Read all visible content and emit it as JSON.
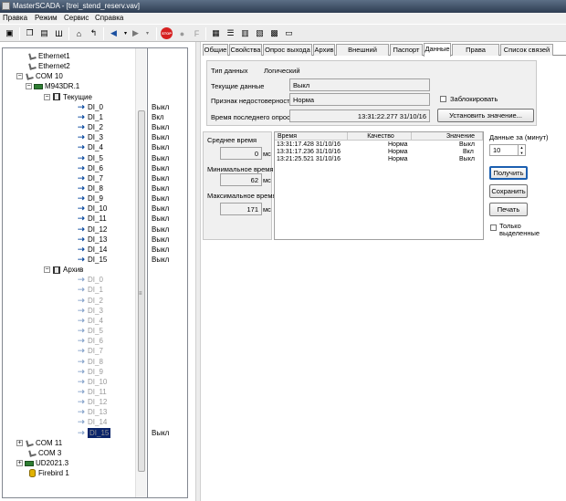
{
  "window": {
    "title": "MasterSCADA - [trei_stend_reserv.vav]"
  },
  "menu": [
    "Правка",
    "Режим",
    "Сервис",
    "Справка"
  ],
  "toolbar": {
    "icons": [
      "save-icon",
      "window-icon",
      "windows-icon",
      "bars-icon",
      "home-icon",
      "up-level-icon",
      "back-icon",
      "forward-icon",
      "stop-icon",
      "record-icon",
      "f-icon",
      "panel-icon",
      "list-icon",
      "table-icon",
      "chart-icon",
      "property-icon",
      "frame-icon"
    ],
    "stop_label": "STOP",
    "f_label": "F"
  },
  "tree": {
    "items": [
      {
        "label": "Ethernet1",
        "indent": 28,
        "icon": "network-icon"
      },
      {
        "label": "Ethernet2",
        "indent": 28,
        "icon": "network-icon"
      },
      {
        "label": "COM 10",
        "indent": 28,
        "icon": "network-icon",
        "toggle": "−"
      },
      {
        "label": "M943DR.1",
        "indent": 38,
        "icon": "device-icon",
        "toggle": "−"
      },
      {
        "label": "Текущие",
        "indent": 58,
        "icon": "folder-icon",
        "toggle": "−"
      },
      {
        "label": "DI_0",
        "indent": 82,
        "icon": "di-icon",
        "value": "Выкл"
      },
      {
        "label": "DI_1",
        "indent": 82,
        "icon": "di-icon",
        "value": "Вкл"
      },
      {
        "label": "DI_2",
        "indent": 82,
        "icon": "di-icon",
        "value": "Выкл"
      },
      {
        "label": "DI_3",
        "indent": 82,
        "icon": "di-icon",
        "value": "Выкл"
      },
      {
        "label": "DI_4",
        "indent": 82,
        "icon": "di-icon",
        "value": "Выкл"
      },
      {
        "label": "DI_5",
        "indent": 82,
        "icon": "di-icon",
        "value": "Выкл"
      },
      {
        "label": "DI_6",
        "indent": 82,
        "icon": "di-icon",
        "value": "Выкл"
      },
      {
        "label": "DI_7",
        "indent": 82,
        "icon": "di-icon",
        "value": "Выкл"
      },
      {
        "label": "DI_8",
        "indent": 82,
        "icon": "di-icon",
        "value": "Выкл"
      },
      {
        "label": "DI_9",
        "indent": 82,
        "icon": "di-icon",
        "value": "Выкл"
      },
      {
        "label": "DI_10",
        "indent": 82,
        "icon": "di-icon",
        "value": "Выкл"
      },
      {
        "label": "DI_11",
        "indent": 82,
        "icon": "di-icon",
        "value": "Выкл"
      },
      {
        "label": "DI_12",
        "indent": 82,
        "icon": "di-icon",
        "value": "Выкл"
      },
      {
        "label": "DI_13",
        "indent": 82,
        "icon": "di-icon",
        "value": "Выкл"
      },
      {
        "label": "DI_14",
        "indent": 82,
        "icon": "di-icon",
        "value": "Выкл"
      },
      {
        "label": "DI_15",
        "indent": 82,
        "icon": "di-icon",
        "value": "Выкл"
      },
      {
        "label": "Архив",
        "indent": 58,
        "icon": "folder-icon",
        "toggle": "−"
      },
      {
        "label": "DI_0",
        "indent": 82,
        "icon": "di-icon",
        "grey": true
      },
      {
        "label": "DI_1",
        "indent": 82,
        "icon": "di-icon",
        "grey": true
      },
      {
        "label": "DI_2",
        "indent": 82,
        "icon": "di-icon",
        "grey": true
      },
      {
        "label": "DI_3",
        "indent": 82,
        "icon": "di-icon",
        "grey": true
      },
      {
        "label": "DI_4",
        "indent": 82,
        "icon": "di-icon",
        "grey": true
      },
      {
        "label": "DI_5",
        "indent": 82,
        "icon": "di-icon",
        "grey": true
      },
      {
        "label": "DI_6",
        "indent": 82,
        "icon": "di-icon",
        "grey": true
      },
      {
        "label": "DI_7",
        "indent": 82,
        "icon": "di-icon",
        "grey": true
      },
      {
        "label": "DI_8",
        "indent": 82,
        "icon": "di-icon",
        "grey": true
      },
      {
        "label": "DI_9",
        "indent": 82,
        "icon": "di-icon",
        "grey": true
      },
      {
        "label": "DI_10",
        "indent": 82,
        "icon": "di-icon",
        "grey": true
      },
      {
        "label": "DI_11",
        "indent": 82,
        "icon": "di-icon",
        "grey": true
      },
      {
        "label": "DI_12",
        "indent": 82,
        "icon": "di-icon",
        "grey": true
      },
      {
        "label": "DI_13",
        "indent": 82,
        "icon": "di-icon",
        "grey": true
      },
      {
        "label": "DI_14",
        "indent": 82,
        "icon": "di-icon",
        "grey": true
      },
      {
        "label": "DI_15",
        "indent": 82,
        "icon": "di-icon",
        "grey": true,
        "selected": true,
        "value": "Выкл"
      },
      {
        "label": "COM 11",
        "indent": 28,
        "icon": "network-icon",
        "toggle": "+"
      },
      {
        "label": "COM 3",
        "indent": 28,
        "icon": "network-icon"
      },
      {
        "label": "UD2021.3",
        "indent": 28,
        "icon": "device-icon",
        "toggle": "+"
      },
      {
        "label": "Firebird 1",
        "indent": 28,
        "icon": "database-icon"
      }
    ]
  },
  "tabs": [
    "Общие",
    "Свойства",
    "Опрос выхода",
    "Архив",
    "Внешний доступ",
    "Паспорт",
    "Данные",
    "Права доступа",
    "Список связей"
  ],
  "active_tab_index": 6,
  "data_panel": {
    "type_label": "Тип данных",
    "type_value": "Логический",
    "current_label": "Текущие данные",
    "current_value": "Выкл",
    "quality_label": "Признак недостоверности",
    "quality_value": "Норма",
    "lock_label": "Заблокировать",
    "poll_label": "Время последнего опроса",
    "poll_value": "13:31:22.277 31/10/16",
    "set_button": "Установить значение..."
  },
  "stats": {
    "avg_label": "Среднее время",
    "avg_value": "0",
    "min_label": "Минимальное время",
    "min_value": "62",
    "max_label": "Максимальное время",
    "max_value": "171",
    "unit": "мс"
  },
  "history": {
    "columns": [
      "Время",
      "Качество",
      "Значение"
    ],
    "rows": [
      [
        "13:31:17.428 31/10/16",
        "Норма",
        "Выкл"
      ],
      [
        "13:31:17.236 31/10/16",
        "Норма",
        "Вкл"
      ],
      [
        "13:21:25.521 31/10/16",
        "Норма",
        "Выкл"
      ]
    ]
  },
  "right_controls": {
    "days_label": "Данные за (минут)",
    "days_value": "10",
    "get_button": "Получить",
    "save_button": "Сохранить",
    "print_button": "Печать",
    "only_selected_label": "Только выделенные"
  }
}
